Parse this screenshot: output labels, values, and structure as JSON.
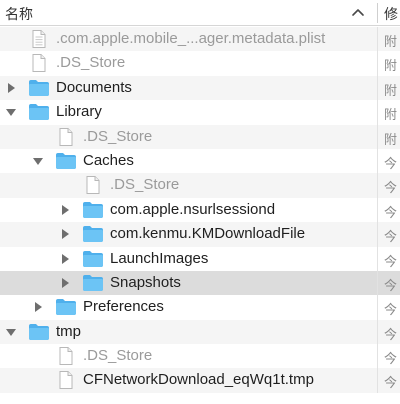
{
  "header": {
    "name_column": "名称",
    "second_column": "修"
  },
  "colors": {
    "folder": "#6cc4f5",
    "selected_row": "#dcdcdc",
    "alt_row": "#f5f5f5",
    "dim_text": "#9a9a9a"
  },
  "rows": [
    {
      "label": ".com.apple.mobile_...ager.metadata.plist",
      "kind": "file",
      "icon": "plist-file-icon",
      "dim": true,
      "col2": "附"
    },
    {
      "label": ".DS_Store",
      "kind": "file",
      "icon": "document-icon",
      "dim": true,
      "col2": "附"
    },
    {
      "label": "Documents",
      "kind": "folder",
      "icon": "folder-icon",
      "expanded": false,
      "col2": "附"
    },
    {
      "label": "Library",
      "kind": "folder",
      "icon": "folder-icon",
      "expanded": true,
      "col2": "附"
    },
    {
      "label": ".DS_Store",
      "kind": "file",
      "icon": "document-icon",
      "dim": true,
      "col2": "附"
    },
    {
      "label": "Caches",
      "kind": "folder",
      "icon": "folder-icon",
      "expanded": true,
      "col2": "今"
    },
    {
      "label": ".DS_Store",
      "kind": "file",
      "icon": "document-icon",
      "dim": true,
      "col2": "今"
    },
    {
      "label": "com.apple.nsurlsessiond",
      "kind": "folder",
      "icon": "folder-icon",
      "expanded": false,
      "col2": "今"
    },
    {
      "label": "com.kenmu.KMDownloadFile",
      "kind": "folder",
      "icon": "folder-icon",
      "expanded": false,
      "col2": "今"
    },
    {
      "label": "LaunchImages",
      "kind": "folder",
      "icon": "folder-icon",
      "expanded": false,
      "col2": "今"
    },
    {
      "label": "Snapshots",
      "kind": "folder",
      "icon": "folder-icon",
      "expanded": false,
      "selected": true,
      "col2": "今"
    },
    {
      "label": "Preferences",
      "kind": "folder",
      "icon": "folder-icon",
      "expanded": false,
      "col2": "今"
    },
    {
      "label": "tmp",
      "kind": "folder",
      "icon": "folder-icon",
      "expanded": true,
      "col2": "今"
    },
    {
      "label": ".DS_Store",
      "kind": "file",
      "icon": "document-icon",
      "dim": true,
      "col2": "今"
    },
    {
      "label": "CFNetworkDownload_eqWq1t.tmp",
      "kind": "file",
      "icon": "document-icon",
      "dim": false,
      "col2": "今"
    }
  ]
}
